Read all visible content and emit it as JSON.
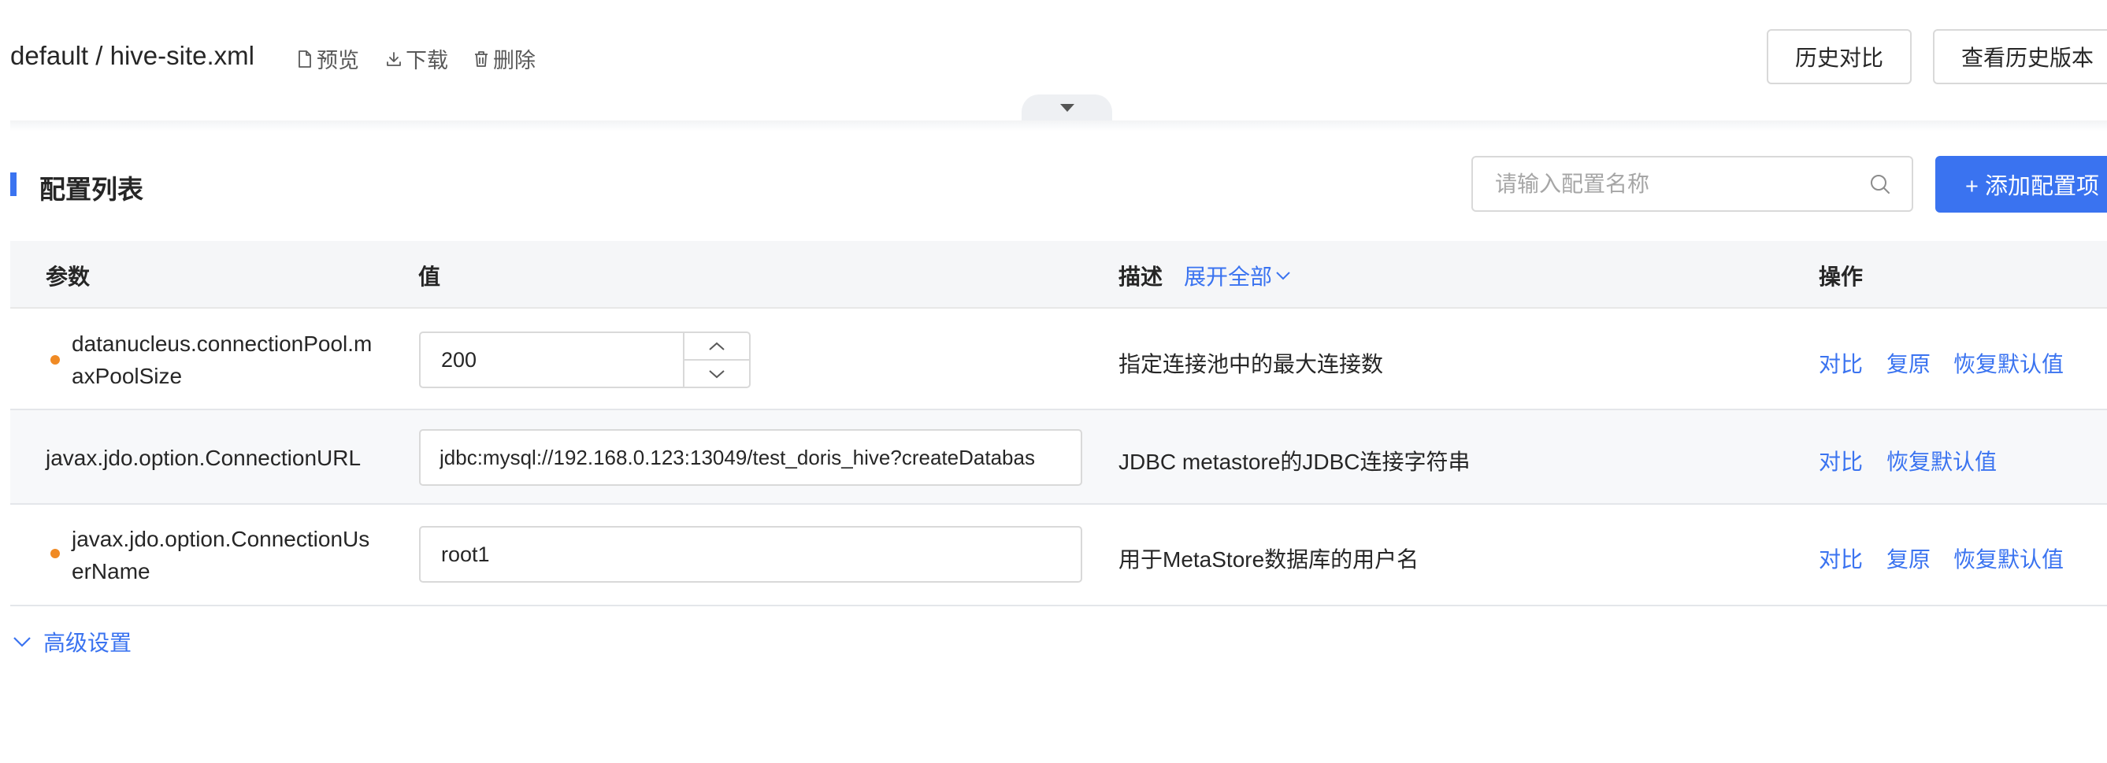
{
  "header": {
    "file_title": "default / hive-site.xml",
    "actions": [
      {
        "label": "预览",
        "icon": "file-icon"
      },
      {
        "label": "下载",
        "icon": "download-icon"
      },
      {
        "label": "删除",
        "icon": "trash-icon"
      }
    ],
    "buttons": {
      "history_compare": "历史对比",
      "view_history": "查看历史版本"
    }
  },
  "section": {
    "title": "配置列表",
    "search_placeholder": "请输入配置名称",
    "add_button": "+ 添加配置项"
  },
  "table": {
    "columns": {
      "param": "参数",
      "value": "值",
      "desc": "描述",
      "expand_all": "展开全部",
      "ops": "操作"
    },
    "rows": [
      {
        "param_lines": [
          "datanucleus.connectionPool.m",
          "axPoolSize"
        ],
        "modified": true,
        "value": "200",
        "value_type": "number",
        "desc": "指定连接池中的最大连接数",
        "ops": [
          "对比",
          "复原",
          "恢复默认值"
        ]
      },
      {
        "param_lines": [
          "javax.jdo.option.ConnectionURL"
        ],
        "modified": false,
        "value": "jdbc:mysql://192.168.0.123:13049/test_doris_hive?createDatabas",
        "value_type": "text",
        "desc": "JDBC metastore的JDBC连接字符串",
        "ops": [
          "对比",
          "恢复默认值"
        ]
      },
      {
        "param_lines": [
          "javax.jdo.option.ConnectionUs",
          "erName"
        ],
        "modified": true,
        "value": "root1",
        "value_type": "text",
        "desc": "用于MetaStore数据库的用户名",
        "ops": [
          "对比",
          "复原",
          "恢复默认值"
        ]
      }
    ]
  },
  "advanced": {
    "label": "高级设置"
  },
  "colors": {
    "accent": "#3a73f0",
    "modified_dot": "#f08a24"
  }
}
